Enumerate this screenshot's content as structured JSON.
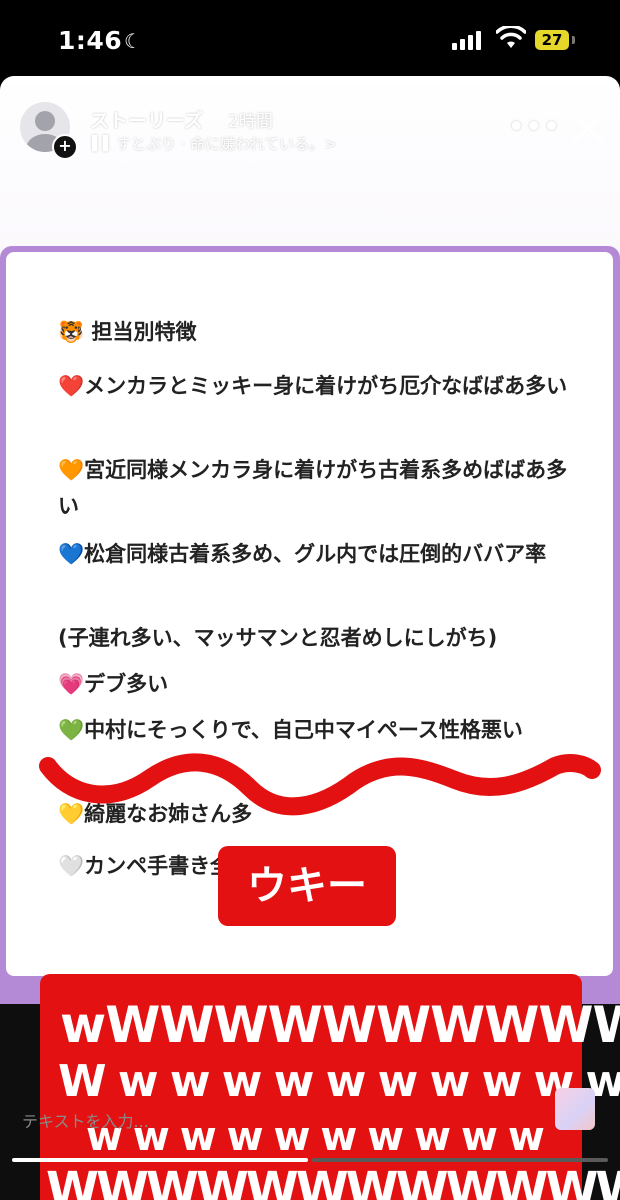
{
  "status_bar": {
    "time": "1:46",
    "battery": "27"
  },
  "story_header": {
    "username": "ストーリーズ",
    "time_ago": "2時間",
    "music": "すとぷり · 命に嫌われている。>"
  },
  "card": {
    "title": "🐯 担当別特徴",
    "lines": [
      "❤️メンカラとミッキー身に着けがち厄介なばばあ多い",
      "🧡宮近同様メンカラ身に着けがち古着系多めばばあ多い",
      "💙松倉同様古着系多め、グル内では圧倒的ババア率",
      "(子連れ多い、マッサマンと忍者めしにしがち)",
      "💗デブ多い",
      "💚中村にそっくりで、自己中マイペース性格悪い",
      "💛綺麗なお姉さん多",
      "🤍カンペ手書き全部担タレ"
    ]
  },
  "stickers": {
    "title": "ウキー",
    "lines": [
      "wWWWWWWWWWW",
      "W w w w w w w w w w w",
      "w w w w w w w w w w",
      "WWWWWWWWWWWW"
    ]
  },
  "input": {
    "placeholder": "テキストを入力..."
  },
  "colors": {
    "sticker_red": "#e31111",
    "card_border": "#b48ad6",
    "battery": "#e6d72b"
  },
  "progress": {
    "segment_1": 1.0,
    "segment_2": 0.0
  }
}
